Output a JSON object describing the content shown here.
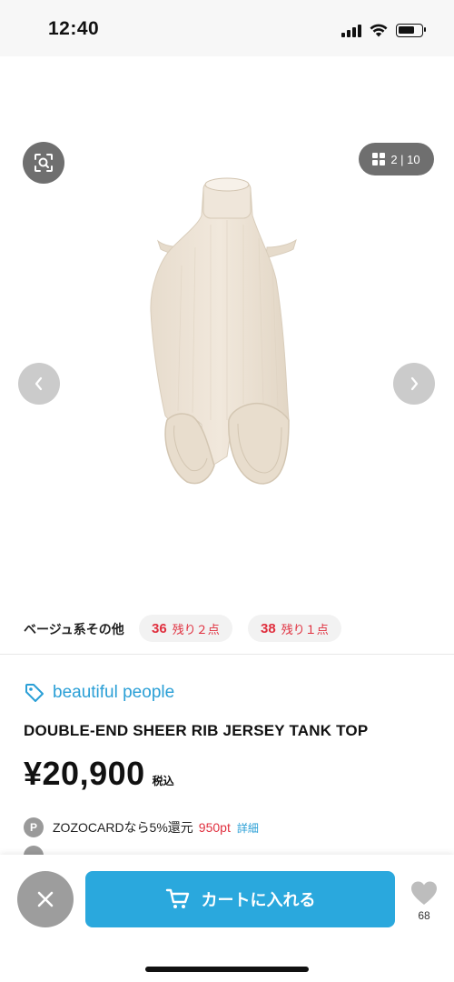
{
  "status_bar": {
    "time": "12:40"
  },
  "gallery": {
    "counter": "2 | 10",
    "image_alt": "ribbed tank top product photo"
  },
  "color": {
    "name": "ベージュ系その他",
    "sizes": [
      {
        "size": "36",
        "stock": "残り２点"
      },
      {
        "size": "38",
        "stock": "残り１点"
      }
    ]
  },
  "product": {
    "brand": "beautiful people",
    "name": "DOUBLE-END SHEER RIB JERSEY TANK TOP",
    "price": "¥20,900",
    "tax_label": "税込",
    "zozocard_text": "ZOZOCARDなら5%還元",
    "points": "950pt",
    "detail_link": "詳細"
  },
  "bottom_bar": {
    "cart_label": "カートに入れる",
    "favorite_count": "68"
  },
  "colors": {
    "accent_blue": "#2aa8dd",
    "sale_red": "#e0303f",
    "product_beige": "#ece1d3"
  }
}
